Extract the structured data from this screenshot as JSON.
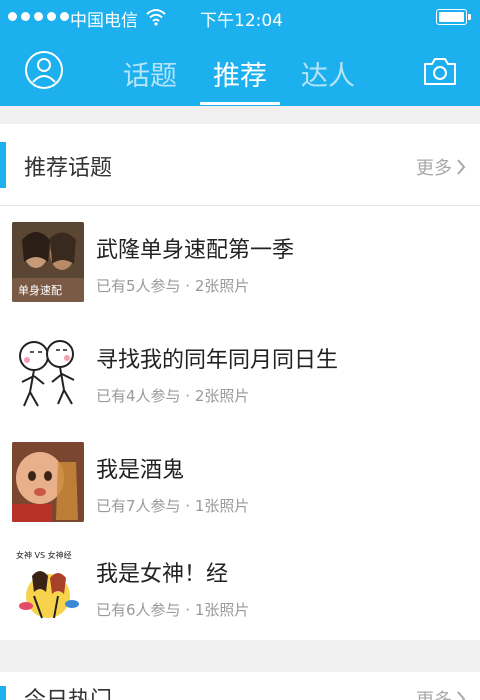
{
  "status_bar": {
    "carrier": "中国电信",
    "time": "下午12:04"
  },
  "nav": {
    "tabs": [
      "话题",
      "推荐",
      "达人"
    ],
    "active_tab": "推荐",
    "left_icon": "user-avatar-icon",
    "right_icon": "camera-icon"
  },
  "colors": {
    "brand": "#1cb0ee",
    "tab_inactive": "#b5e4f9"
  },
  "recommended": {
    "title": "推荐话题",
    "more": "更多",
    "items": [
      {
        "title": "武隆单身速配第一季",
        "meta": "已有5人参与 · 2张照片",
        "thumb_caption": "单身速配"
      },
      {
        "title": "寻找我的同年同月同日生",
        "meta": "已有4人参与 · 2张照片",
        "thumb_caption": ""
      },
      {
        "title": "我是酒鬼",
        "meta": "已有7人参与 · 1张照片",
        "thumb_caption": ""
      },
      {
        "title": "我是女神！经",
        "meta": "已有6人参与 · 1张照片",
        "thumb_caption": "女神 VS 女神经"
      }
    ]
  },
  "today_hot": {
    "title": "今日热门",
    "more": "更多"
  }
}
